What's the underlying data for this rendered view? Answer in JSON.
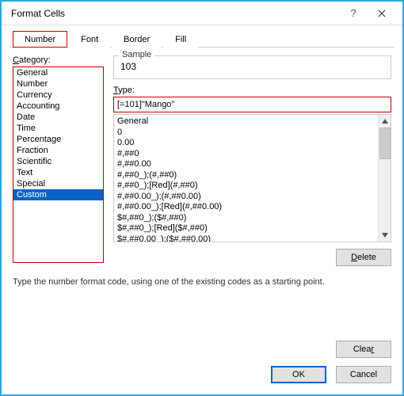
{
  "window": {
    "title": "Format Cells"
  },
  "tabs": [
    "Number",
    "Font",
    "Border",
    "Fill"
  ],
  "active_tab": 0,
  "category": {
    "label": "Category:",
    "items": [
      "General",
      "Number",
      "Currency",
      "Accounting",
      "Date",
      "Time",
      "Percentage",
      "Fraction",
      "Scientific",
      "Text",
      "Special",
      "Custom"
    ],
    "selected_index": 11
  },
  "sample": {
    "label": "Sample",
    "value": "103"
  },
  "type": {
    "label": "Type:",
    "value": "[=101]\"Mango\"",
    "formats": [
      "General",
      "0",
      "0.00",
      "#,##0",
      "#,##0.00",
      "#,##0_);(#,##0)",
      "#,##0_);[Red](#,##0)",
      "#,##0.00_);(#,##0.00)",
      "#,##0.00_);[Red](#,##0.00)",
      "$#,##0_);($#,##0)",
      "$#,##0_);[Red]($#,##0)",
      "$#,##0.00_);($#,##0.00)"
    ]
  },
  "buttons": {
    "delete": "Delete",
    "clear": "Clear",
    "ok": "OK",
    "cancel": "Cancel"
  },
  "help_text": "Type the number format code, using one of the existing codes as a starting point."
}
